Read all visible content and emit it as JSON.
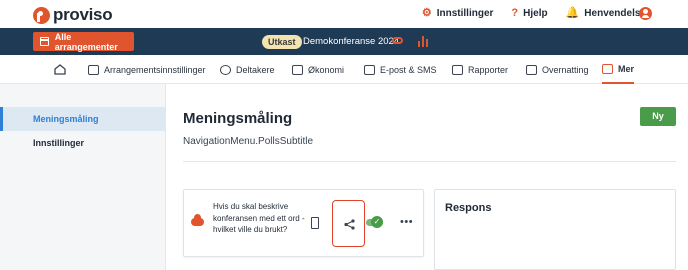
{
  "brand": {
    "name": "proviso",
    "accent": "#e0542e",
    "dark": "#1f3a55"
  },
  "topnav": {
    "items": [
      {
        "label": "Innstillinger",
        "icon": "gear-icon"
      },
      {
        "label": "Hjelp",
        "icon": "help-icon"
      },
      {
        "label": "Henvendelse",
        "icon": "bell-icon"
      }
    ],
    "user_icon": "user-icon"
  },
  "eventbar": {
    "all_events_label": "Alle arrangementer",
    "status": "Utkast",
    "event_name": "Demokonferanse 2024"
  },
  "tabs": [
    {
      "label": "Arrangementsinnstillinger"
    },
    {
      "label": "Deltakere"
    },
    {
      "label": "Økonomi"
    },
    {
      "label": "E-post & SMS"
    },
    {
      "label": "Rapporter"
    },
    {
      "label": "Overnatting"
    },
    {
      "label": "Mer",
      "active": true
    }
  ],
  "sidebar": {
    "items": [
      {
        "label": "Meningsmåling",
        "active": true
      },
      {
        "label": "Innstillinger"
      }
    ]
  },
  "main": {
    "title": "Meningsmåling",
    "subtitle": "NavigationMenu.PollsSubtitle",
    "new_button": "Ny"
  },
  "poll": {
    "question": "Hvis du skal beskrive konferansen med ett ord - hvilket ville du brukt?",
    "active": true
  },
  "response": {
    "title": "Respons"
  }
}
